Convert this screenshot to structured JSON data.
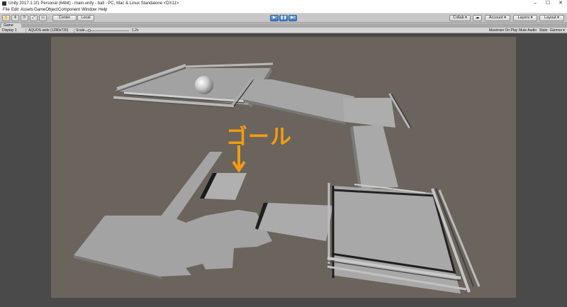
{
  "window": {
    "title": "Unity 2017.1.1f1 Personal (64bit) - main.unity - ball - PC, Mac & Linux Standalone <DX11>",
    "controls": [
      "–",
      "☐",
      "✕"
    ]
  },
  "menu": [
    "File",
    "Edit",
    "Assets",
    "GameObject",
    "Component",
    "Window",
    "Help"
  ],
  "toolbar": {
    "pivot_label": "Center",
    "space_label": "Local",
    "collab_label": "Collab ▾",
    "account_label": "Account ▾",
    "layers_label": "Layers ▾",
    "layout_label": "Layout ▾"
  },
  "tab": {
    "label": "Game"
  },
  "gamebar": {
    "display": "Display 1",
    "aspect": "AQUOS wide (1280x720)",
    "scale_label": "Scale",
    "scale_value": "1.2x",
    "maximize": "Maximize On Play",
    "mute": "Mute Audio",
    "stats": "Stats",
    "gizmos": "Gizmos ▾"
  },
  "annotation": {
    "goal_text": "ゴール",
    "arrow": "↓"
  },
  "colors": {
    "annotation": "#f39c12",
    "scene_background": "#6a645c",
    "platform": "#9e9e9e",
    "play_button": "#3b78c4"
  }
}
